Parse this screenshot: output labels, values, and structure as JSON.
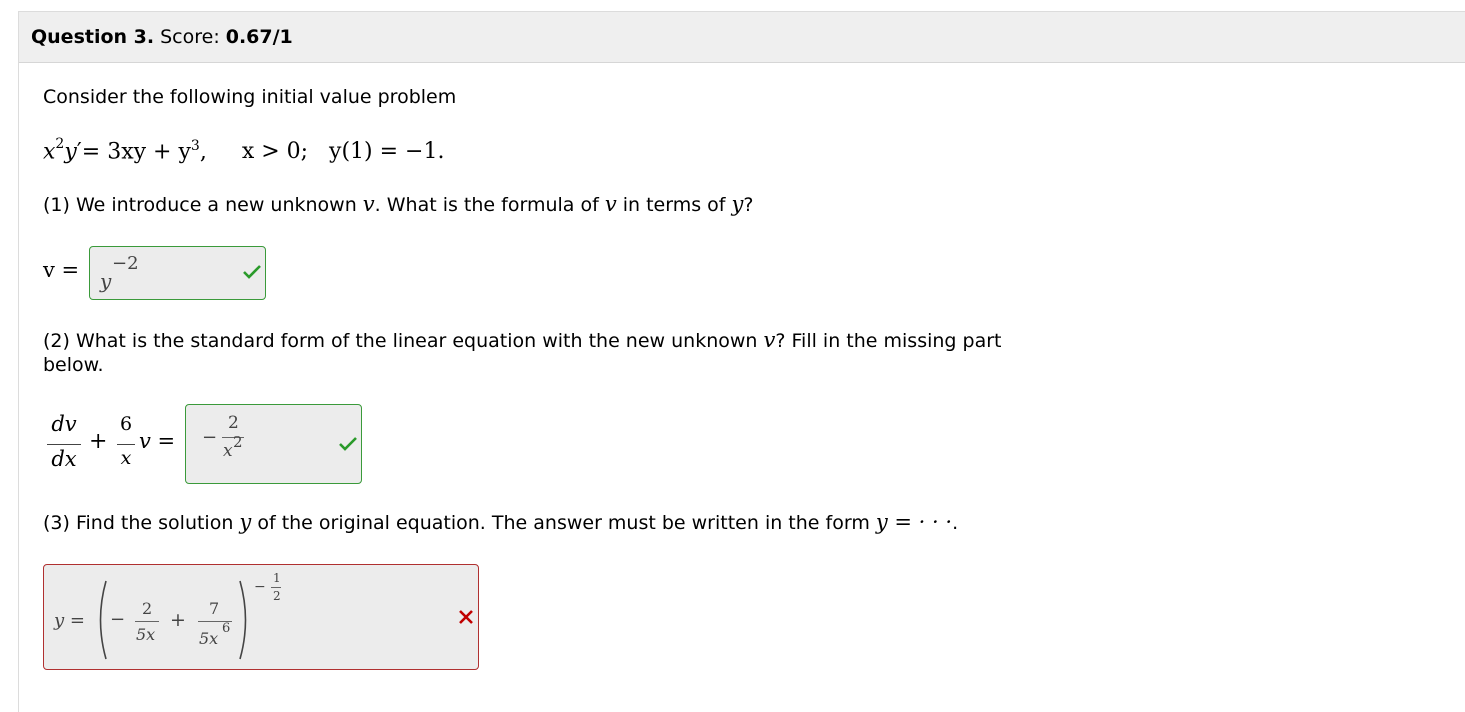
{
  "question": {
    "label": "Question 3.",
    "score_label": "Score:",
    "score_value": "0.67/1"
  },
  "intro": "Consider the following initial value problem",
  "equation": {
    "lhs_base_x": "x",
    "lhs_exp_x": "2",
    "lhs_y": "y",
    "prime": "′",
    "eq": "= 3xy + y",
    "exp3": "3",
    "comma": ",",
    "condition": "x > 0;   y(1) = −1."
  },
  "part1": {
    "text_a": "(1) We introduce a new unknown ",
    "var_v": "v",
    "text_b": ". What is the formula of ",
    "text_c": " in terms of ",
    "var_y": "y",
    "text_d": "?",
    "prefix": "v =",
    "answer_base": "y",
    "answer_exp": "−2",
    "status": "correct"
  },
  "part2": {
    "text_line1": "(2) What is the standard form of the linear equation with the new unknown ",
    "var_v": "v",
    "text_line1_end": "? Fill in the missing part",
    "text_line2": "below.",
    "lhs_num": "dv",
    "lhs_den": "dx",
    "plus": "+",
    "coef_num": "6",
    "coef_den": "x",
    "after": "v =",
    "answer_sign": "−",
    "answer_num": "2",
    "answer_den": "x",
    "answer_den_exp": "2",
    "status": "correct"
  },
  "part3": {
    "text_a": "(3) Find the solution ",
    "var_y": "y",
    "text_b": " of the original equation. The answer must be written in the form ",
    "form": "y = · · ·",
    "text_c": ".",
    "answer": {
      "prefix": "y =",
      "minus": "−",
      "f1_num": "2",
      "f1_den": "5x",
      "plus": "+",
      "f2_num": "7",
      "f2_den": "5x",
      "f2_den_exp": "6",
      "exp_sign": "−",
      "exp_num": "1",
      "exp_den": "2"
    },
    "status": "incorrect"
  },
  "icons": {
    "correct": "check-icon",
    "incorrect": "cross-icon"
  },
  "colors": {
    "correct": "#2a9a2a",
    "incorrect": "#c00000"
  }
}
